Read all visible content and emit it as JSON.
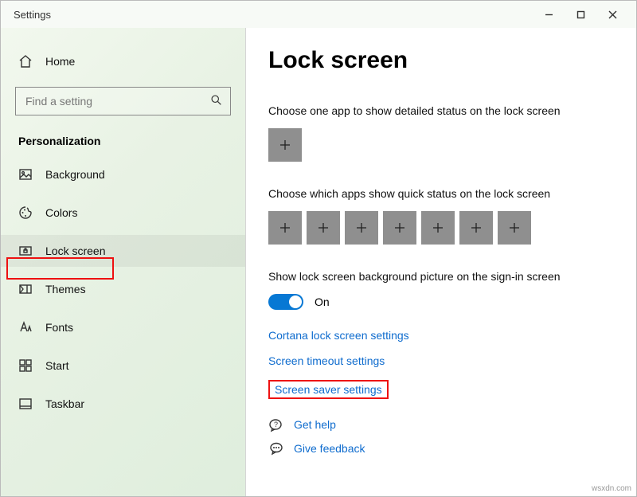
{
  "window": {
    "title": "Settings"
  },
  "sidebar": {
    "home": "Home",
    "search_placeholder": "Find a setting",
    "category": "Personalization",
    "items": [
      {
        "label": "Background"
      },
      {
        "label": "Colors"
      },
      {
        "label": "Lock screen"
      },
      {
        "label": "Themes"
      },
      {
        "label": "Fonts"
      },
      {
        "label": "Start"
      },
      {
        "label": "Taskbar"
      }
    ]
  },
  "main": {
    "heading": "Lock screen",
    "detailed_label": "Choose one app to show detailed status on the lock screen",
    "quick_label": "Choose which apps show quick status on the lock screen",
    "signin_label": "Show lock screen background picture on the sign-in screen",
    "toggle_state": "On",
    "links": {
      "cortana": "Cortana lock screen settings",
      "timeout": "Screen timeout settings",
      "saver": "Screen saver settings"
    },
    "help": "Get help",
    "feedback": "Give feedback"
  },
  "watermark": "wsxdn.com"
}
